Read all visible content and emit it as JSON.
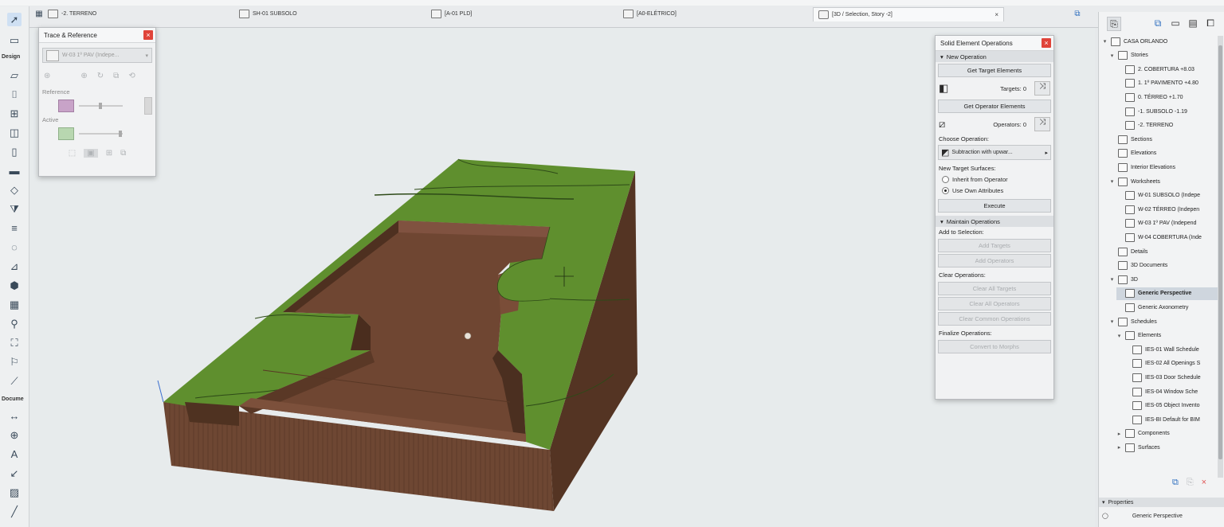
{
  "tabs": [
    {
      "label": "-2. TERRENO"
    },
    {
      "label": "SH-01 SUBSOLO"
    },
    {
      "label": "[A-01 PLD]"
    },
    {
      "label": "[A0-ELÉTRICO]"
    },
    {
      "label": "[3D / Selection, Story -2]",
      "close": "×"
    }
  ],
  "toolbox": {
    "design_label": "Design",
    "document_label": "Docume"
  },
  "trace_reference": {
    "title": "Trace & Reference",
    "dropdown_value": "W-03 1º PAV (Indepe...",
    "reference_label": "Reference",
    "active_label": "Active"
  },
  "seo": {
    "title": "Solid Element Operations",
    "new_operation": "New Operation",
    "get_target": "Get Target Elements",
    "targets": "Targets: 0",
    "get_operator": "Get Operator Elements",
    "operators": "Operators: 0",
    "choose_operation": "Choose Operation:",
    "operation_value": "Subtraction with upwar...",
    "new_target_surfaces": "New Target Surfaces:",
    "inherit": "Inherit from Operator",
    "use_own": "Use Own Attributes",
    "execute": "Execute",
    "maintain": "Maintain Operations",
    "add_to_selection": "Add to Selection:",
    "add_targets": "Add Targets",
    "add_operators": "Add Operators",
    "clear_operations": "Clear Operations:",
    "clear_all_targets": "Clear All Targets",
    "clear_all_operators": "Clear All Operators",
    "clear_common": "Clear Common Operations",
    "finalize": "Finalize Operations:",
    "convert": "Convert to Morphs"
  },
  "navigator": {
    "items": [
      {
        "label": "CASA ORLANDO",
        "arrow": "▾"
      },
      {
        "label": "Stories",
        "arrow": "▾"
      },
      {
        "label": "2. COBERTURA +8.03",
        "arrow": ""
      },
      {
        "label": "1. 1º PAVIMENTO +4.80",
        "arrow": ""
      },
      {
        "label": "0. TÉRREO +1.70",
        "arrow": ""
      },
      {
        "label": "-1. SUBSOLO -1.19",
        "arrow": ""
      },
      {
        "label": "-2. TERRENO",
        "arrow": ""
      },
      {
        "label": "Sections",
        "arrow": ""
      },
      {
        "label": "Elevations",
        "arrow": ""
      },
      {
        "label": "Interior Elevations",
        "arrow": ""
      },
      {
        "label": "Worksheets",
        "arrow": "▾"
      },
      {
        "label": "W-01 SUBSOLO (Indepe",
        "arrow": ""
      },
      {
        "label": "W-02 TÉRREO (Indepen",
        "arrow": ""
      },
      {
        "label": "W-03 1º PAV (Independ",
        "arrow": ""
      },
      {
        "label": "W-04 COBERTURA (Inde",
        "arrow": ""
      },
      {
        "label": "Details",
        "arrow": ""
      },
      {
        "label": "3D Documents",
        "arrow": ""
      },
      {
        "label": "3D",
        "arrow": "▾"
      },
      {
        "label": "Generic Perspective",
        "arrow": ""
      },
      {
        "label": "Generic Axonometry",
        "arrow": ""
      },
      {
        "label": "Schedules",
        "arrow": "▾"
      },
      {
        "label": "Elements",
        "arrow": "▾"
      },
      {
        "label": "IES-01 Wall Schedule",
        "arrow": ""
      },
      {
        "label": "IES-02 All Openings S",
        "arrow": ""
      },
      {
        "label": "IES-03 Door Schedule",
        "arrow": ""
      },
      {
        "label": "IES-04 Window Sche",
        "arrow": ""
      },
      {
        "label": "IES-05 Object Invento",
        "arrow": ""
      },
      {
        "label": "IES-BI Default for BIM",
        "arrow": ""
      },
      {
        "label": "Components",
        "arrow": "▸"
      },
      {
        "label": "Surfaces",
        "arrow": "▸"
      }
    ],
    "properties_label": "Properties",
    "properties_value": "Generic Perspective"
  },
  "colors": {
    "grass": "#5a8a2c",
    "soil": "#6b4632",
    "background": "#e7ebec"
  }
}
